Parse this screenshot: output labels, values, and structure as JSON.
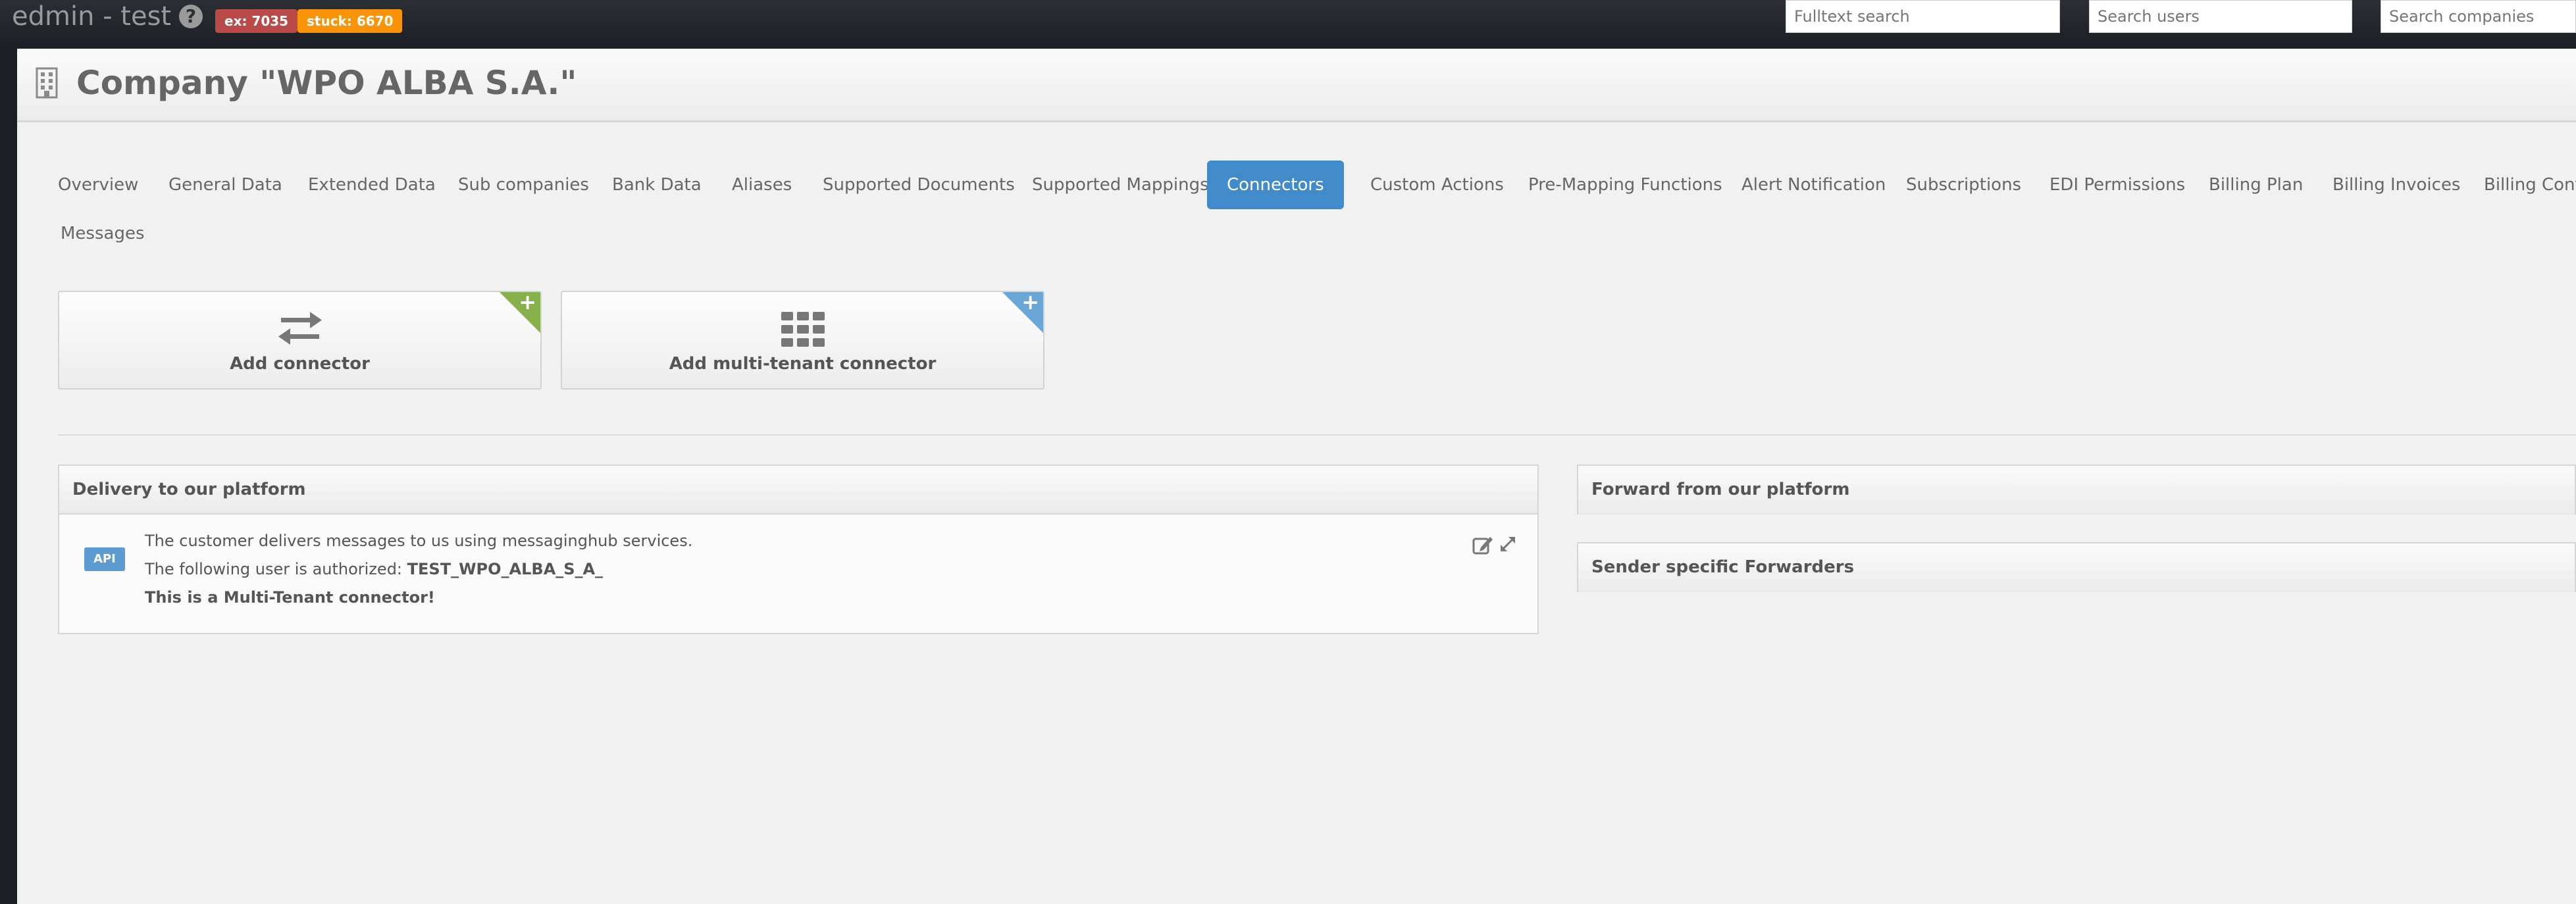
{
  "navbar": {
    "brand": "edmin - test",
    "help_icon": "question-circle-icon",
    "badges": {
      "ex": "ex: 7035",
      "stuck": "stuck: 6670"
    },
    "search": {
      "fulltext_placeholder": "Fulltext search",
      "users_placeholder": "Search users",
      "companies_placeholder": "Search companies"
    }
  },
  "page": {
    "title": "Company \"WPO ALBA S.A.\"",
    "title_icon": "building-icon"
  },
  "tabs": [
    {
      "label": "Overview"
    },
    {
      "label": "General Data"
    },
    {
      "label": "Extended Data"
    },
    {
      "label": "Sub companies"
    },
    {
      "label": "Bank Data"
    },
    {
      "label": "Aliases"
    },
    {
      "label": "Supported Documents"
    },
    {
      "label": "Supported Mappings"
    },
    {
      "label": "Connectors"
    },
    {
      "label": "Custom Actions"
    },
    {
      "label": "Pre-Mapping Functions"
    },
    {
      "label": "Alert Notification"
    },
    {
      "label": "Subscriptions"
    },
    {
      "label": "EDI Permissions"
    },
    {
      "label": "Billing Plan"
    },
    {
      "label": "Billing Invoices"
    },
    {
      "label": "Billing Configur"
    },
    {
      "label": "Messages"
    }
  ],
  "active_tab": "Connectors",
  "actions": {
    "add_connector": "Add connector",
    "add_multi_tenant_connector": "Add multi-tenant connector",
    "corner_plus": "+"
  },
  "delivery_panel": {
    "title": "Delivery to our platform",
    "api_label": "API",
    "line1": "The customer delivers messages to us using messaginghub services.",
    "line2_prefix": "The following user is authorized: ",
    "line2_user": "TEST_WPO_ALBA_S_A_",
    "line3": "This is a Multi-Tenant connector!"
  },
  "forward_panel": {
    "title": "Forward from our platform"
  },
  "sender_panel": {
    "title": "Sender specific Forwarders"
  },
  "colors": {
    "active_tab": "#428bca",
    "badge_ex": "#b94a48",
    "badge_stuck": "#f89406",
    "corner_green": "#86b04b",
    "corner_blue": "#6aa6d6",
    "api_label": "#5b9bd1"
  }
}
